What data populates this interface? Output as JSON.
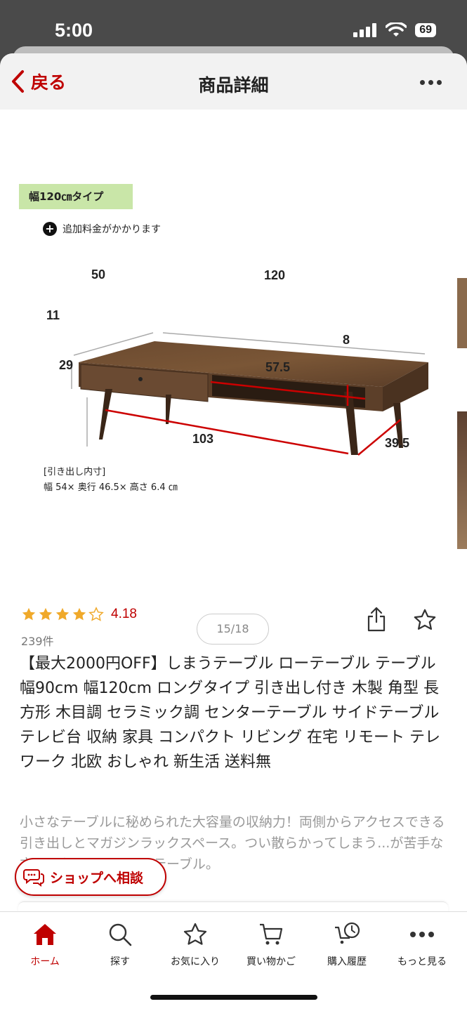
{
  "status_bar": {
    "time": "5:00",
    "battery": "69"
  },
  "nav": {
    "back_label": "戻る",
    "title": "商品詳細"
  },
  "gallery": {
    "size_tag": "幅120㎝タイプ",
    "extra_note": "追加料金がかかります",
    "dimensions": {
      "depth": "50",
      "width": "120",
      "top_thickness": "11",
      "leg_height": "29",
      "shelf_height": "8",
      "shelf_width": "57.5",
      "leg_span_width": "103",
      "leg_span_depth": "39.5"
    },
    "drawer_caption_heading": "[引き出し内寸]",
    "drawer_caption_size": "幅 54× 奥行 46.5× 高さ 6.4 ㎝",
    "page_indicator": "15/18"
  },
  "product": {
    "rating": 4.18,
    "rating_label": "4.18",
    "review_count": "239件",
    "title": "【最大2000円OFF】しまうテーブル ローテーブル テーブル 幅90cm 幅120cm ロングタイプ 引き出し付き 木製 角型 長方形 木目調 セラミック調 センターテーブル サイドテーブル テレビ台 収納 家具 コンパクト リビング 在宅 リモート テレワーク 北欧 おしゃれ 新生活 送料無",
    "description": "小さなテーブルに秘められた大容量の収納力！両側からアクセスできる引き出しとマガジンラックスペース。つい散らかってしまう...が苦手な方にもおすすめのローテーブル。"
  },
  "consult_button": "ショップへ相談",
  "tabs": [
    {
      "label": "ホーム",
      "icon": "home-icon",
      "active": true
    },
    {
      "label": "探す",
      "icon": "search-icon",
      "active": false
    },
    {
      "label": "お気に入り",
      "icon": "star-icon",
      "active": false
    },
    {
      "label": "買い物かご",
      "icon": "cart-icon",
      "active": false
    },
    {
      "label": "購入履歴",
      "icon": "history-icon",
      "active": false
    },
    {
      "label": "もっと見る",
      "icon": "more-icon",
      "active": false
    }
  ],
  "colors": {
    "brand_red": "#bf0000",
    "star_gold": "#f0a92a",
    "tag_green": "#c9e6a8"
  }
}
